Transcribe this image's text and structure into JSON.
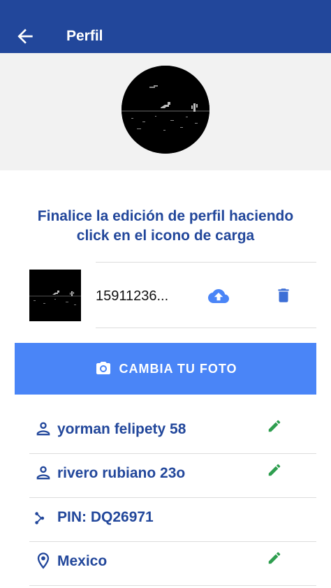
{
  "appbar": {
    "title": "Perfil",
    "color": "#22479b"
  },
  "profile": {
    "avatar_icon": "dino-game-image"
  },
  "info_text_line1": "Finalice la edición de perfil haciendo",
  "info_text_line2": "click en el icono de carga",
  "file": {
    "name": "15911236...",
    "upload_icon": "cloud-upload-icon",
    "delete_icon": "trash-icon"
  },
  "change_photo": {
    "label": "CAMBIA TU FOTO",
    "icon": "camera-icon",
    "color": "#4a85f7"
  },
  "fields": [
    {
      "icon": "person-icon",
      "value": "yorman felipety 58",
      "editable": true
    },
    {
      "icon": "person-icon",
      "value": "rivero rubiano 23o",
      "editable": true
    },
    {
      "icon": "pin-share-icon",
      "value": "PIN: DQ26971",
      "editable": false
    },
    {
      "icon": "location-icon",
      "value": "Mexico",
      "editable": true
    }
  ],
  "edit_color": "#2e9e4f"
}
